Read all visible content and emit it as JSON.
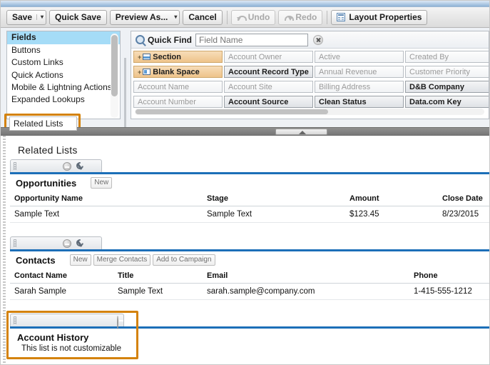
{
  "toolbar": {
    "save_label": "Save",
    "save_caret": "▾",
    "quick_save_label": "Quick Save",
    "preview_as_label": "Preview As...",
    "preview_caret": "▾",
    "cancel_label": "Cancel",
    "undo_label": "Undo",
    "redo_label": "Redo",
    "layout_properties_label": "Layout Properties"
  },
  "sidebar": {
    "items": [
      {
        "label": "Fields",
        "selected": true
      },
      {
        "label": "Buttons",
        "selected": false
      },
      {
        "label": "Custom Links",
        "selected": false
      },
      {
        "label": "Quick Actions",
        "selected": false
      },
      {
        "label": "Mobile & Lightning Actions",
        "selected": false
      },
      {
        "label": "Expanded Lookups",
        "selected": false
      },
      {
        "label": "Related Lists",
        "selected": false
      }
    ],
    "related_lists_label": "Related Lists"
  },
  "palette": {
    "quick_find_label": "Quick Find",
    "quick_find_placeholder": "Field Name",
    "quick_find_value": "",
    "clear_icon": "clear-icon",
    "special_items": [
      {
        "label": "Section"
      },
      {
        "label": "Blank Space"
      }
    ],
    "fields": [
      {
        "label": "Account Owner",
        "available": false
      },
      {
        "label": "Active",
        "available": false
      },
      {
        "label": "Created By",
        "available": false
      },
      {
        "label": "Account Record Type",
        "available": true
      },
      {
        "label": "Annual Revenue",
        "available": false
      },
      {
        "label": "Customer Priority",
        "available": false
      },
      {
        "label": "Account Name",
        "available": false
      },
      {
        "label": "Account Site",
        "available": false
      },
      {
        "label": "Billing Address",
        "available": false
      },
      {
        "label": "D&B Company",
        "available": true
      },
      {
        "label": "Account Number",
        "available": false
      },
      {
        "label": "Account Source",
        "available": true
      },
      {
        "label": "Clean Status",
        "available": true
      },
      {
        "label": "Data.com Key",
        "available": true
      }
    ]
  },
  "canvas": {
    "title": "Related Lists",
    "related_lists": [
      {
        "name": "Opportunities",
        "actions": [
          "New"
        ],
        "columns": [
          "Opportunity Name",
          "Stage",
          "Amount",
          "Close Date"
        ],
        "rows": [
          [
            "Sample Text",
            "Sample Text",
            "$123.45",
            "8/23/2015"
          ]
        ]
      },
      {
        "name": "Contacts",
        "actions": [
          "New",
          "Merge Contacts",
          "Add to Campaign"
        ],
        "columns": [
          "Contact Name",
          "Title",
          "Email",
          "Phone"
        ],
        "rows": [
          [
            "Sarah Sample",
            "Sample Text",
            "sarah.sample@company.com",
            "1-415-555-1212"
          ]
        ]
      }
    ],
    "account_history": {
      "name": "Account History",
      "note": "This list is not customizable"
    }
  },
  "colors": {
    "highlight_orange": "#d4820a",
    "selection_blue": "#a5dcf7",
    "rule_blue": "#1c6fb8",
    "special_tan": "#eec38a"
  }
}
